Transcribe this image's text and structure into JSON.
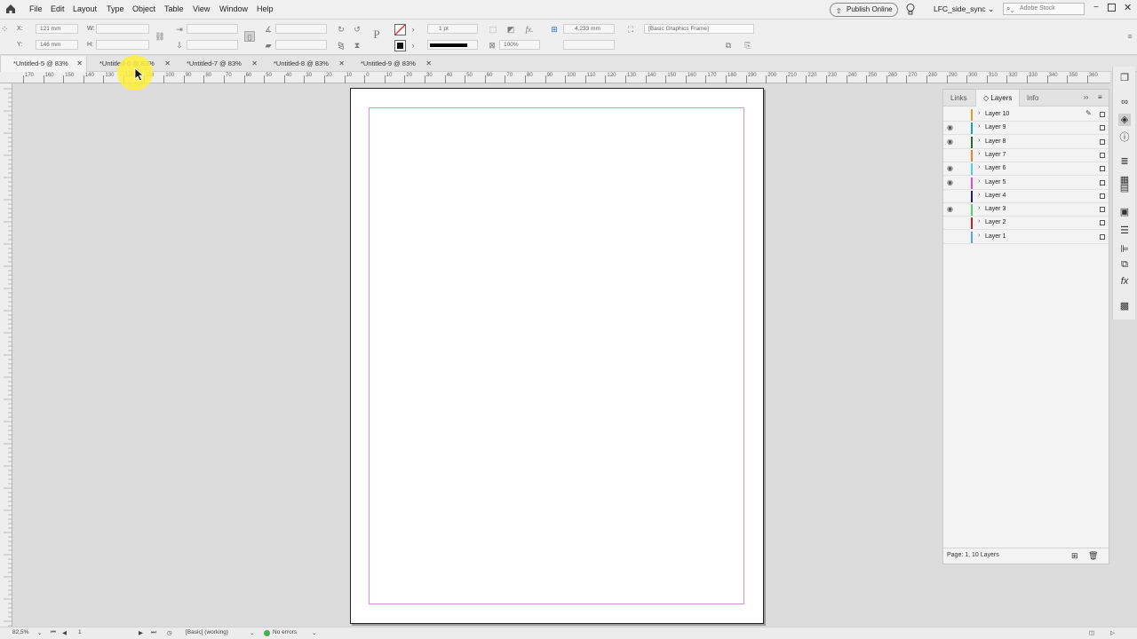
{
  "menu": {
    "items": [
      "File",
      "Edit",
      "Layout",
      "Type",
      "Object",
      "Table",
      "View",
      "Window",
      "Help"
    ],
    "publish_label": "Publish Online",
    "workspace": "LFC_side_sync",
    "stock_placeholder": "Adobe Stock"
  },
  "control": {
    "x_label": "X:",
    "x_value": "121 mm",
    "y_label": "Y:",
    "y_value": "146 mm",
    "w_label": "W:",
    "h_label": "H:",
    "stroke_weight": "1 pt",
    "opacity": "100%",
    "gap_value": "4,233 mm",
    "object_style": "[Basic Graphics Frame]",
    "fx_label": "fx."
  },
  "tabs": [
    {
      "label": "*Untitled-5 @ 83%",
      "active": true
    },
    {
      "label": "*Untitled-6 @ 83%",
      "active": false
    },
    {
      "label": "*Untitled-7 @ 83%",
      "active": false
    },
    {
      "label": "*Untitled-8 @ 83%",
      "active": false
    },
    {
      "label": "*Untitled-9 @ 83%",
      "active": false
    }
  ],
  "ruler": {
    "numbers": [
      "170",
      "160",
      "150",
      "140",
      "130",
      "120",
      "110",
      "100",
      "90",
      "80",
      "70",
      "60",
      "50",
      "40",
      "30",
      "20",
      "10",
      "0",
      "10",
      "20",
      "30",
      "40",
      "50",
      "60",
      "70",
      "80",
      "90",
      "100",
      "110",
      "120",
      "130",
      "140",
      "150",
      "160",
      "170",
      "180",
      "190",
      "200",
      "210",
      "220",
      "230",
      "240",
      "250",
      "260",
      "270",
      "280",
      "290",
      "300",
      "310",
      "320",
      "330",
      "340",
      "350",
      "360",
      "370"
    ]
  },
  "layers_panel": {
    "tabs": [
      "Links",
      "Layers",
      "Info"
    ],
    "active_tab": "Layers",
    "layers": [
      {
        "name": "Layer 10",
        "color": "#e89a2c",
        "visible": false
      },
      {
        "name": "Layer 9",
        "color": "#1aa7a7",
        "visible": true
      },
      {
        "name": "Layer 8",
        "color": "#1f6e2a",
        "visible": true
      },
      {
        "name": "Layer 7",
        "color": "#ef7d2a",
        "visible": false
      },
      {
        "name": "Layer 6",
        "color": "#4bd2e6",
        "visible": true
      },
      {
        "name": "Layer 5",
        "color": "#e14ad8",
        "visible": true
      },
      {
        "name": "Layer 4",
        "color": "#1c1c8a",
        "visible": false
      },
      {
        "name": "Layer 3",
        "color": "#53d46a",
        "visible": true
      },
      {
        "name": "Layer 2",
        "color": "#c0202a",
        "visible": false
      },
      {
        "name": "Layer 1",
        "color": "#5aa0e8",
        "visible": false
      }
    ],
    "footer_status": "Page: 1, 10 Layers"
  },
  "statusbar": {
    "zoom": "82,5%",
    "page": "1",
    "preflight_profile": "[Basic] (working)",
    "errors": "No errors"
  },
  "colors": {
    "margin_guide": "#d38fd8",
    "cursor_highlight": "#fff03c",
    "no_errors_dot": "#3fb34f"
  }
}
